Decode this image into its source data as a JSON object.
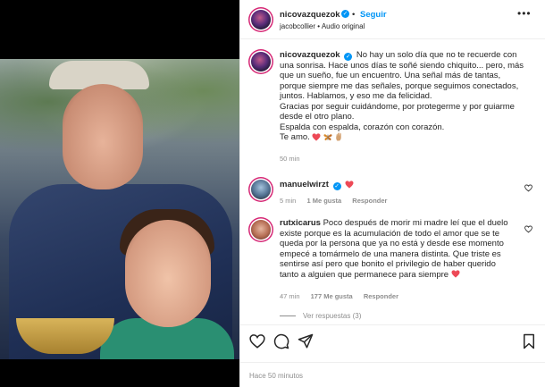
{
  "header": {
    "username": "nicovazquezok",
    "follow_label": "Seguir",
    "separator": "•",
    "audio": "jacobcollier • Audio original",
    "more_label": "•••"
  },
  "caption": {
    "username": "nicovazquezok",
    "lines": [
      "No hay un solo día que no te recuerde con",
      "una sonrisa. Hace unos días te soñé siendo chiquito... pero, más",
      "que un sueño, fue un encuentro. Una señal más de tantas,",
      "porque siempre me das señales, porque seguimos conectados,",
      "juntos. Hablamos, y eso me da felicidad.",
      "Gracias por seguir cuidándome, por protegerme y por guiarme",
      "desde el otro plano.",
      "Espalda con espalda, corazón con corazón.",
      "Te amo."
    ],
    "time": "50 min"
  },
  "comments": [
    {
      "username": "manuelwirzt",
      "text": "",
      "time": "5 min",
      "likes": "1 Me gusta",
      "reply_label": "Responder"
    },
    {
      "username": "rutxicarus",
      "lines": [
        "Poco después de morir mi madre leí que el duelo",
        "existe porque es la acumulación de todo el amor que se te",
        "queda por la persona que ya no está y desde ese momento",
        "empecé a tomármelo de una manera distinta. Que triste es",
        "sentirse así pero que bonito el privilegio de haber querido",
        "tanto a alguien que permanece para siempre"
      ],
      "time": "47 min",
      "likes": "177 Me gusta",
      "reply_label": "Responder"
    }
  ],
  "view_replies": "Ver respuestas (3)",
  "footer_time": "Hace 50 minutos",
  "icons": {
    "like": "heart-icon",
    "comment": "comment-icon",
    "share": "share-icon",
    "save": "bookmark-icon"
  },
  "colors": {
    "accent": "#0095f6",
    "red": "#ed4956",
    "muted": "#8e8e8e"
  }
}
